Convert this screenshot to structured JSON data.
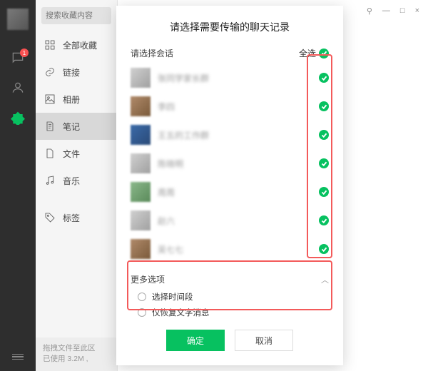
{
  "leftbar": {
    "badge": "1"
  },
  "sidebar": {
    "search_placeholder": "搜索收藏内容",
    "items": [
      {
        "label": "全部收藏"
      },
      {
        "label": "链接"
      },
      {
        "label": "相册"
      },
      {
        "label": "笔记"
      },
      {
        "label": "文件"
      },
      {
        "label": "音乐"
      },
      {
        "label": "标签"
      }
    ],
    "footer_line1": "拖拽文件至此区",
    "footer_line2": "已使用 3.2M ,"
  },
  "titlebar": {
    "pin": "⚲",
    "min": "—",
    "max": "□",
    "close": "×"
  },
  "modal": {
    "title": "请选择需要传输的聊天记录",
    "section_label": "请选择会话",
    "select_all": "全选",
    "conversations": [
      {
        "name": "张同学家长群",
        "av": "d"
      },
      {
        "name": "李四",
        "av": "b"
      },
      {
        "name": "王五的工作群",
        "av": "c"
      },
      {
        "name": "陈晓明",
        "av": "d"
      },
      {
        "name": "周周",
        "av": "e"
      },
      {
        "name": "赵六",
        "av": "d"
      },
      {
        "name": "吴七七",
        "av": "b"
      }
    ],
    "more_label": "更多选项",
    "opt_time": "选择时间段",
    "opt_text": "仅恢复文字消息",
    "ok": "确定",
    "cancel": "取消"
  }
}
